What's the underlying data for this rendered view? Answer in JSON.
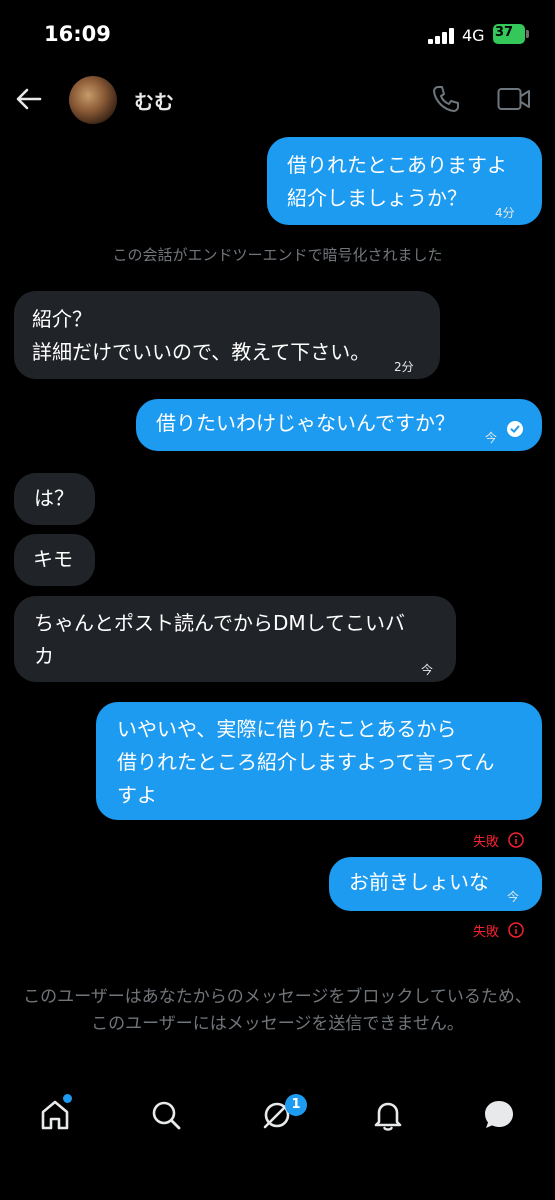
{
  "status_bar": {
    "time": "16:09",
    "network": "4G",
    "battery": "37"
  },
  "header": {
    "contact_name": "むむ"
  },
  "messages": [
    {
      "dir": "out",
      "lines": [
        "借りれたとこありますよ",
        "紹介しましょうか？"
      ],
      "time": "4分"
    },
    {
      "dir": "system",
      "text": "この会話がエンドツーエンドで暗号化されました"
    },
    {
      "dir": "in",
      "lines": [
        "紹介？",
        "詳細だけでいいので、教えて下さい。"
      ],
      "time": "2分"
    },
    {
      "dir": "out",
      "lines": [
        "借りたいわけじゃないんですか？"
      ],
      "time": "今"
    },
    {
      "dir": "in",
      "lines": [
        "は？"
      ]
    },
    {
      "dir": "in",
      "lines": [
        "キモ"
      ]
    },
    {
      "dir": "in",
      "lines": [
        "ちゃんとポスト読んでからDMしてこいバ",
        "カ"
      ],
      "time": "今"
    },
    {
      "dir": "out",
      "lines": [
        "いやいや、実際に借りたことあるから",
        "借りれたところ紹介しますよって言ってん",
        "すよ"
      ],
      "status": "失敗"
    },
    {
      "dir": "out",
      "lines": [
        "お前きしょいな"
      ],
      "time": "今",
      "status": "失敗"
    }
  ],
  "blocked_notice": "このユーザーはあなたからのメッセージをブロックしているため、このユーザーにはメッセージを送信できません。",
  "nav": {
    "dm_badge": "1"
  },
  "colors": {
    "accent": "#1d9bf0",
    "incoming": "#202327",
    "error": "#f4212e"
  },
  "icons": [
    "back-arrow-icon",
    "phone-icon",
    "video-icon",
    "read-check-icon",
    "error-info-icon",
    "home-icon",
    "search-icon",
    "grok-icon",
    "bell-icon",
    "messages-icon"
  ]
}
